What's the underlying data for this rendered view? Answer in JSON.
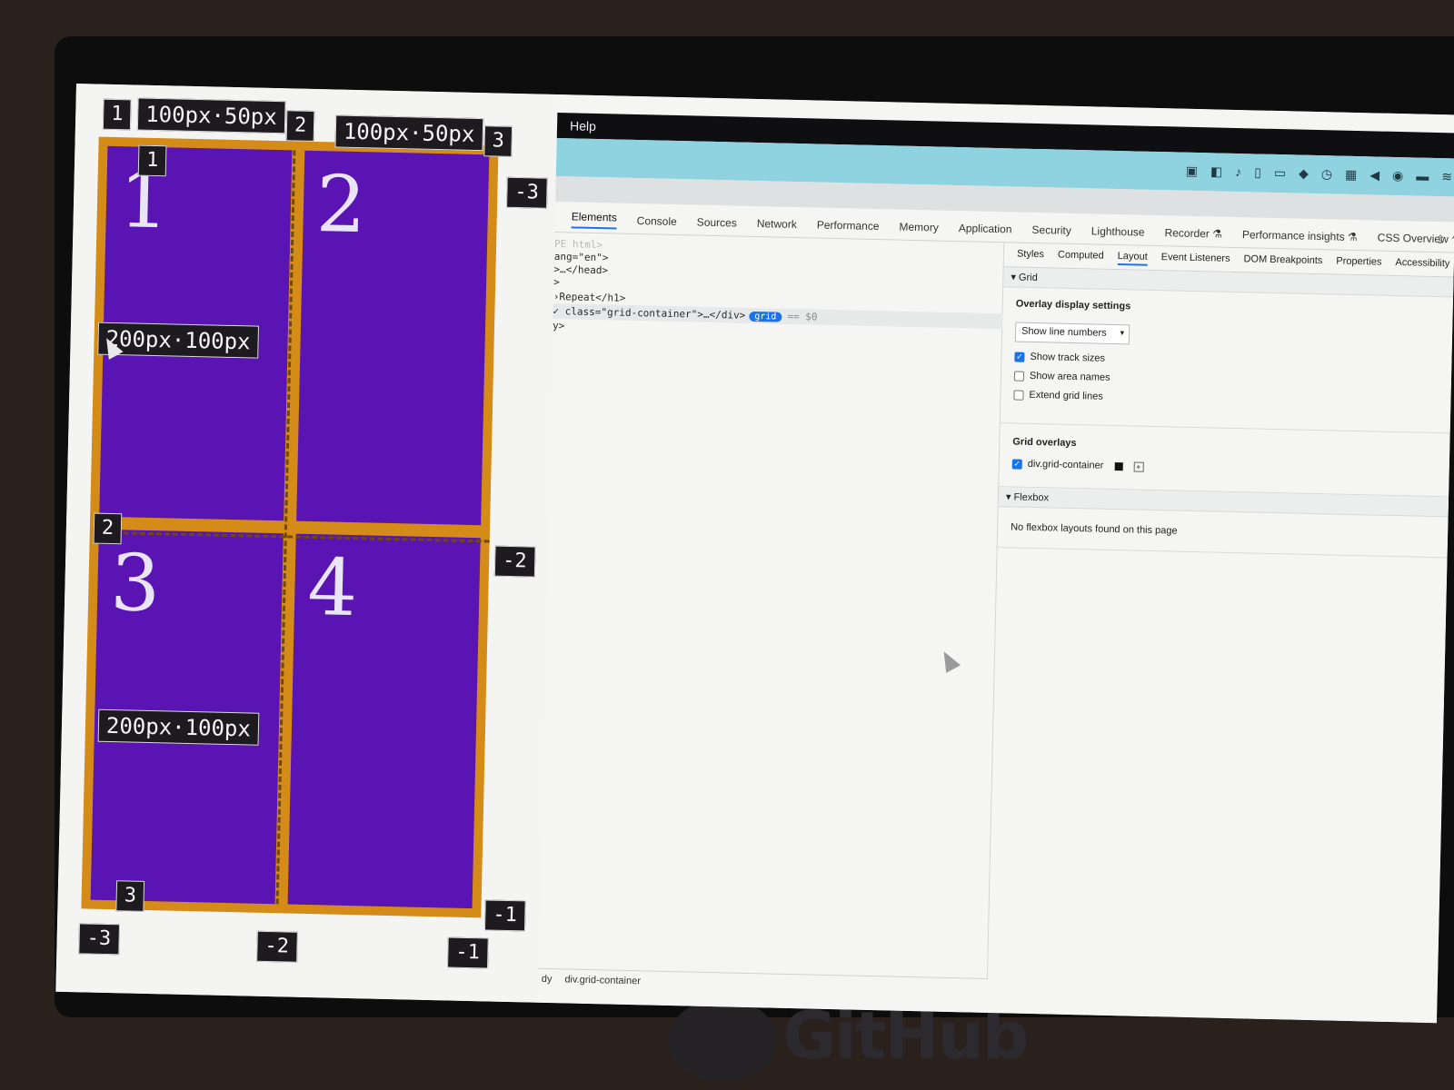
{
  "grid_overlay": {
    "cells": [
      "1",
      "2",
      "3",
      "4"
    ],
    "col_lines_top": [
      "1",
      "2",
      "3"
    ],
    "col_track_sizes": [
      "100px·50px",
      "100px·50px"
    ],
    "row_line_left_1": "1",
    "row_line_left_2": "2",
    "row_line_left_3": "3",
    "row_track_sizes": [
      "200px·100px",
      "200px·100px"
    ],
    "neg_right": [
      "-3",
      "-2",
      "-1"
    ],
    "neg_bottom": [
      "-3",
      "-2",
      "-1"
    ]
  },
  "menu": {
    "help": "Help"
  },
  "tray_icons": [
    "camera-icon",
    "window-icon",
    "bell-icon",
    "clipboard-icon",
    "display-icon",
    "elephant-icon",
    "history-icon",
    "gb-icon",
    "volume-icon",
    "record-icon",
    "battery-icon",
    "wifi-icon"
  ],
  "tabs": [
    "Elements",
    "Console",
    "Sources",
    "Network",
    "Performance",
    "Memory",
    "Application",
    "Security",
    "Lighthouse",
    "Recorder ⚗",
    "Performance insights ⚗",
    "CSS Overview ⚗"
  ],
  "active_tab": "Elements",
  "dom": {
    "line0": "PE html>",
    "line1": "ang=\"en\">",
    "line2": ">…</head>",
    "line3": ">",
    "line4": "›Repeat</h1>",
    "line5": "✓ class=\"grid-container\">…</div>",
    "grid_pill": "grid",
    "dollar": "== $0",
    "line6": "y>"
  },
  "subtabs": [
    "Styles",
    "Computed",
    "Layout",
    "Event Listeners",
    "DOM Breakpoints",
    "Properties",
    "Accessibility"
  ],
  "layout": {
    "grid_section": "▾ Grid",
    "overlay_heading": "Overlay display settings",
    "select_value": "Show line numbers",
    "show_track_sizes": "Show track sizes",
    "show_area_names": "Show area names",
    "extend_grid_lines": "Extend grid lines",
    "grid_overlays_heading": "Grid overlays",
    "overlay_item": "div.grid-container",
    "flexbox_section": "▾ Flexbox",
    "no_flexbox": "No flexbox layouts found on this page"
  },
  "statusbar": {
    "crumb1": "dy",
    "crumb2": "div.grid-container"
  },
  "watermark": "GitHub"
}
